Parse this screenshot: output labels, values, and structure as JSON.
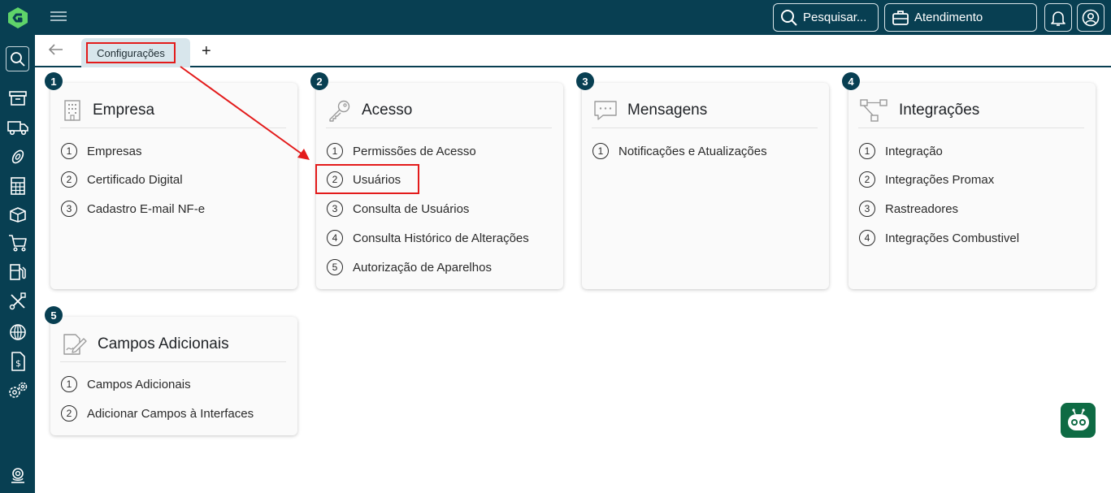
{
  "topbar": {
    "search_label": "Pesquisar...",
    "atendimento_label": "Atendimento"
  },
  "tabs": {
    "active_label": "Configurações",
    "add_label": "+"
  },
  "cards": [
    {
      "badge": "1",
      "title": "Empresa",
      "icon": "building-icon",
      "items": [
        {
          "num": "1",
          "label": "Empresas"
        },
        {
          "num": "2",
          "label": "Certificado Digital"
        },
        {
          "num": "3",
          "label": "Cadastro E-mail NF-e"
        }
      ]
    },
    {
      "badge": "2",
      "title": "Acesso",
      "icon": "key-icon",
      "items": [
        {
          "num": "1",
          "label": "Permissões de Acesso"
        },
        {
          "num": "2",
          "label": "Usuários"
        },
        {
          "num": "3",
          "label": "Consulta de Usuários"
        },
        {
          "num": "4",
          "label": "Consulta Histórico de Alterações"
        },
        {
          "num": "5",
          "label": "Autorização de Aparelhos"
        }
      ]
    },
    {
      "badge": "3",
      "title": "Mensagens",
      "icon": "message-icon",
      "items": [
        {
          "num": "1",
          "label": "Notificações e Atualizações"
        }
      ]
    },
    {
      "badge": "4",
      "title": "Integrações",
      "icon": "flow-icon",
      "items": [
        {
          "num": "1",
          "label": "Integração"
        },
        {
          "num": "2",
          "label": "Integrações Promax"
        },
        {
          "num": "3",
          "label": "Rastreadores"
        },
        {
          "num": "4",
          "label": "Integrações Combustivel"
        }
      ]
    },
    {
      "badge": "5",
      "title": "Campos Adicionais",
      "icon": "edit-document-icon",
      "items": [
        {
          "num": "1",
          "label": "Campos Adicionais"
        },
        {
          "num": "2",
          "label": "Adicionar Campos à Interfaces"
        }
      ]
    }
  ],
  "sidebar_icons": [
    "search-icon",
    "archive-icon",
    "truck-icon",
    "tire-icon",
    "calculator-icon",
    "box-icon",
    "cart-icon",
    "fuel-icon",
    "tools-icon",
    "globe-icon",
    "invoice-icon",
    "settings-icon",
    "support-icon"
  ],
  "colors": {
    "primary": "#083f52",
    "highlight": "#e31b1b",
    "bot": "#0e6b44",
    "logo": "#5fd46a"
  }
}
